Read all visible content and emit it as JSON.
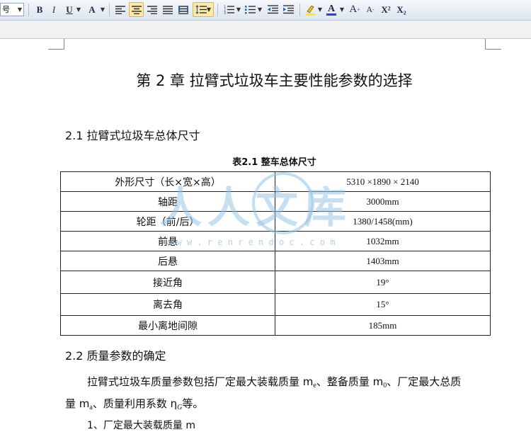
{
  "toolbar": {
    "font_size": "号",
    "bold": "B",
    "italic": "I",
    "underline": "U",
    "highlight_letter": "A",
    "font_color_letter": "A",
    "grow_font": "A",
    "shrink_font": "A",
    "superscript": "X²",
    "subscript": "X₂"
  },
  "document": {
    "chapter_title": "第 2 章  拉臂式垃圾车主要性能参数的选择",
    "section_2_1": "2.1  拉臂式垃圾车总体尺寸",
    "table_caption": "表2.1  整车总体尺寸",
    "table_rows": [
      {
        "label": "外形尺寸（长×宽×高）",
        "value": "5310 ×1890 × 2140"
      },
      {
        "label": "轴距",
        "value": "3000mm"
      },
      {
        "label": "轮距（前/后）",
        "value": "1380/1458(mm)"
      },
      {
        "label": "前悬",
        "value": "1032mm"
      },
      {
        "label": "后悬",
        "value": "1403mm"
      },
      {
        "label": "接近角",
        "value": "19°"
      },
      {
        "label": "离去角",
        "value": "15°"
      },
      {
        "label": "最小离地间隙",
        "value": "185mm"
      }
    ],
    "section_2_2": "2.2 质量参数的确定",
    "para_line1_a": "拉臂式垃圾车质量参数包括厂定最大装载质量 m",
    "para_line1_sub1": "e",
    "para_line1_b": "、整备质量 m",
    "para_line1_sub2": "0",
    "para_line1_c": "、厂定最大总质",
    "para_line2_a": "量 m",
    "para_line2_sub": "a",
    "para_line2_b": "、质量利用系数 η",
    "para_line2_sub2": "G",
    "para_line2_c": "等。",
    "list_item_1": "1、厂定最大装载质量 m"
  },
  "watermark": {
    "text": "人人文库",
    "url": "w w w . r e n r e n d o c . c o m"
  }
}
